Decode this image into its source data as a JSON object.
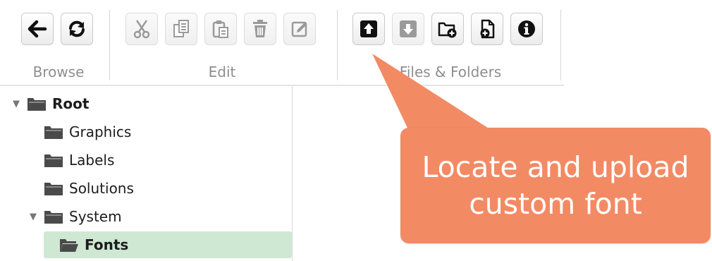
{
  "toolbar": {
    "groups": {
      "browse": {
        "label": "Browse"
      },
      "edit": {
        "label": "Edit"
      },
      "files": {
        "label": "Files & Folders"
      }
    }
  },
  "icons": {
    "browse": [
      "back-arrow-icon",
      "refresh-icon"
    ],
    "edit": [
      "cut-icon",
      "copy-icon",
      "paste-icon",
      "delete-icon",
      "edit-icon"
    ],
    "files": [
      "upload-icon",
      "download-icon",
      "new-folder-icon",
      "new-file-icon",
      "info-icon"
    ]
  },
  "tree": {
    "root": "Root",
    "items": [
      "Graphics",
      "Labels",
      "Solutions"
    ],
    "system": "System",
    "system_children": [
      "Fonts"
    ]
  },
  "callout": {
    "line1": "Locate and upload",
    "line2": "custom font"
  },
  "colors": {
    "callout": "#f28a64",
    "selected_row": "#cfe8d4",
    "folder": "#4a4a4a"
  }
}
